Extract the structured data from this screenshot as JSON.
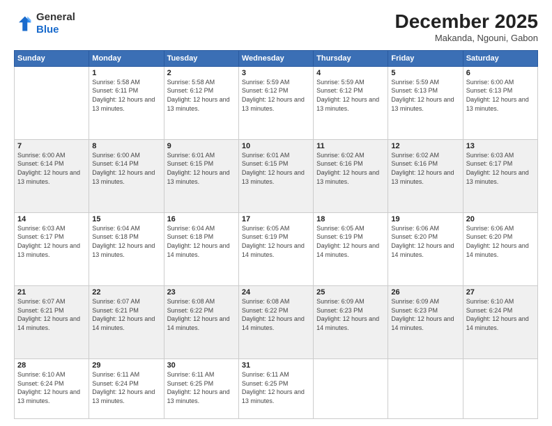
{
  "header": {
    "logo_line1": "General",
    "logo_line2": "Blue",
    "title": "December 2025",
    "subtitle": "Makanda, Ngouni, Gabon"
  },
  "days_of_week": [
    "Sunday",
    "Monday",
    "Tuesday",
    "Wednesday",
    "Thursday",
    "Friday",
    "Saturday"
  ],
  "weeks": [
    [
      {
        "day": "",
        "info": ""
      },
      {
        "day": "1",
        "info": "Sunrise: 5:58 AM\nSunset: 6:11 PM\nDaylight: 12 hours\nand 13 minutes."
      },
      {
        "day": "2",
        "info": "Sunrise: 5:58 AM\nSunset: 6:12 PM\nDaylight: 12 hours\nand 13 minutes."
      },
      {
        "day": "3",
        "info": "Sunrise: 5:59 AM\nSunset: 6:12 PM\nDaylight: 12 hours\nand 13 minutes."
      },
      {
        "day": "4",
        "info": "Sunrise: 5:59 AM\nSunset: 6:12 PM\nDaylight: 12 hours\nand 13 minutes."
      },
      {
        "day": "5",
        "info": "Sunrise: 5:59 AM\nSunset: 6:13 PM\nDaylight: 12 hours\nand 13 minutes."
      },
      {
        "day": "6",
        "info": "Sunrise: 6:00 AM\nSunset: 6:13 PM\nDaylight: 12 hours\nand 13 minutes."
      }
    ],
    [
      {
        "day": "7",
        "info": "Sunrise: 6:00 AM\nSunset: 6:14 PM\nDaylight: 12 hours\nand 13 minutes."
      },
      {
        "day": "8",
        "info": "Sunrise: 6:00 AM\nSunset: 6:14 PM\nDaylight: 12 hours\nand 13 minutes."
      },
      {
        "day": "9",
        "info": "Sunrise: 6:01 AM\nSunset: 6:15 PM\nDaylight: 12 hours\nand 13 minutes."
      },
      {
        "day": "10",
        "info": "Sunrise: 6:01 AM\nSunset: 6:15 PM\nDaylight: 12 hours\nand 13 minutes."
      },
      {
        "day": "11",
        "info": "Sunrise: 6:02 AM\nSunset: 6:16 PM\nDaylight: 12 hours\nand 13 minutes."
      },
      {
        "day": "12",
        "info": "Sunrise: 6:02 AM\nSunset: 6:16 PM\nDaylight: 12 hours\nand 13 minutes."
      },
      {
        "day": "13",
        "info": "Sunrise: 6:03 AM\nSunset: 6:17 PM\nDaylight: 12 hours\nand 13 minutes."
      }
    ],
    [
      {
        "day": "14",
        "info": "Sunrise: 6:03 AM\nSunset: 6:17 PM\nDaylight: 12 hours\nand 13 minutes."
      },
      {
        "day": "15",
        "info": "Sunrise: 6:04 AM\nSunset: 6:18 PM\nDaylight: 12 hours\nand 13 minutes."
      },
      {
        "day": "16",
        "info": "Sunrise: 6:04 AM\nSunset: 6:18 PM\nDaylight: 12 hours\nand 14 minutes."
      },
      {
        "day": "17",
        "info": "Sunrise: 6:05 AM\nSunset: 6:19 PM\nDaylight: 12 hours\nand 14 minutes."
      },
      {
        "day": "18",
        "info": "Sunrise: 6:05 AM\nSunset: 6:19 PM\nDaylight: 12 hours\nand 14 minutes."
      },
      {
        "day": "19",
        "info": "Sunrise: 6:06 AM\nSunset: 6:20 PM\nDaylight: 12 hours\nand 14 minutes."
      },
      {
        "day": "20",
        "info": "Sunrise: 6:06 AM\nSunset: 6:20 PM\nDaylight: 12 hours\nand 14 minutes."
      }
    ],
    [
      {
        "day": "21",
        "info": "Sunrise: 6:07 AM\nSunset: 6:21 PM\nDaylight: 12 hours\nand 14 minutes."
      },
      {
        "day": "22",
        "info": "Sunrise: 6:07 AM\nSunset: 6:21 PM\nDaylight: 12 hours\nand 14 minutes."
      },
      {
        "day": "23",
        "info": "Sunrise: 6:08 AM\nSunset: 6:22 PM\nDaylight: 12 hours\nand 14 minutes."
      },
      {
        "day": "24",
        "info": "Sunrise: 6:08 AM\nSunset: 6:22 PM\nDaylight: 12 hours\nand 14 minutes."
      },
      {
        "day": "25",
        "info": "Sunrise: 6:09 AM\nSunset: 6:23 PM\nDaylight: 12 hours\nand 14 minutes."
      },
      {
        "day": "26",
        "info": "Sunrise: 6:09 AM\nSunset: 6:23 PM\nDaylight: 12 hours\nand 14 minutes."
      },
      {
        "day": "27",
        "info": "Sunrise: 6:10 AM\nSunset: 6:24 PM\nDaylight: 12 hours\nand 14 minutes."
      }
    ],
    [
      {
        "day": "28",
        "info": "Sunrise: 6:10 AM\nSunset: 6:24 PM\nDaylight: 12 hours\nand 13 minutes."
      },
      {
        "day": "29",
        "info": "Sunrise: 6:11 AM\nSunset: 6:24 PM\nDaylight: 12 hours\nand 13 minutes."
      },
      {
        "day": "30",
        "info": "Sunrise: 6:11 AM\nSunset: 6:25 PM\nDaylight: 12 hours\nand 13 minutes."
      },
      {
        "day": "31",
        "info": "Sunrise: 6:11 AM\nSunset: 6:25 PM\nDaylight: 12 hours\nand 13 minutes."
      },
      {
        "day": "",
        "info": ""
      },
      {
        "day": "",
        "info": ""
      },
      {
        "day": "",
        "info": ""
      }
    ]
  ]
}
